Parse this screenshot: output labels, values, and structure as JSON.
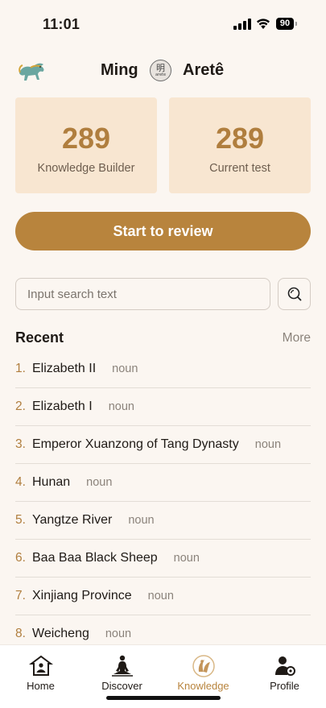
{
  "status_bar": {
    "time": "11:01",
    "battery": "90"
  },
  "header": {
    "brand_left": "Ming",
    "seal_char": "明",
    "seal_sub": "arete",
    "brand_right": "Aretê"
  },
  "stats": [
    {
      "value": "289",
      "label": "Knowledge Builder"
    },
    {
      "value": "289",
      "label": "Current test"
    }
  ],
  "review_button": "Start to review",
  "search": {
    "placeholder": "Input search text",
    "value": ""
  },
  "recent": {
    "title": "Recent",
    "more": "More",
    "items": [
      {
        "num": "1.",
        "word": "Elizabeth II",
        "pos": "noun"
      },
      {
        "num": "2.",
        "word": "Elizabeth I",
        "pos": "noun"
      },
      {
        "num": "3.",
        "word": "Emperor Xuanzong of Tang Dynasty",
        "pos": "noun"
      },
      {
        "num": "4.",
        "word": "Hunan",
        "pos": "noun"
      },
      {
        "num": "5.",
        "word": "Yangtze River",
        "pos": "noun"
      },
      {
        "num": "6.",
        "word": "Baa Baa Black Sheep",
        "pos": "noun"
      },
      {
        "num": "7.",
        "word": "Xinjiang Province",
        "pos": "noun"
      },
      {
        "num": "8.",
        "word": "Weicheng",
        "pos": "noun"
      }
    ]
  },
  "tabs": [
    {
      "label": "Home",
      "icon": "home-icon"
    },
    {
      "label": "Discover",
      "icon": "meditation-icon"
    },
    {
      "label": "Knowledge",
      "icon": "knowledge-icon",
      "active": true
    },
    {
      "label": "Profile",
      "icon": "profile-icon"
    }
  ],
  "colors": {
    "accent": "#b8843d",
    "card_bg": "#f8e6d1",
    "page_bg": "#fbf6f1"
  }
}
